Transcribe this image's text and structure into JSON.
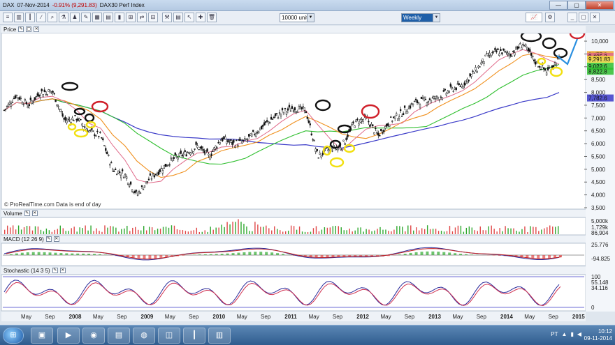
{
  "titlebar": {
    "symbol": "DAX",
    "date": "07-Nov-2014",
    "change": "-0.91% (9,291.83)",
    "index_name": "DAX30 Perf Index",
    "min_label": "—",
    "max_label": "▢",
    "close_label": "✕"
  },
  "toolbar": {
    "units_value": "10000 units",
    "period_value": "Weekly"
  },
  "panels": {
    "price": "Price",
    "volume": "Volume",
    "macd": "MACD (12 26 9)",
    "stochastic": "Stochastic (14 3 5)"
  },
  "watermark": "© ProRealTime.com  Data is end of day",
  "price_axis": [
    "10,000",
    "9,500",
    "9,000",
    "8,500",
    "8,000",
    "7,500",
    "7,000",
    "6,500",
    "6,000",
    "5,500",
    "5,000",
    "4,500",
    "4,000",
    "3,500"
  ],
  "price_tags": {
    "t1": "9,477.3",
    "t2": "9,405.3",
    "t3": "9,291.83",
    "t4": "9,022.6",
    "t5": "8,822.8",
    "t6": "7,782.6"
  },
  "volume_axis": [
    "5,000k",
    "1,729k",
    "86,904"
  ],
  "macd_axis": [
    "25.776",
    "-94.825"
  ],
  "stoch_axis": [
    "100",
    "55.148",
    "34.116",
    "0"
  ],
  "time_axis": [
    "May",
    "Sep",
    "2008",
    "May",
    "Sep",
    "2009",
    "May",
    "Sep",
    "2010",
    "May",
    "Sep",
    "2011",
    "May",
    "Sep",
    "2012",
    "May",
    "Sep",
    "2013",
    "May",
    "Sep",
    "2014",
    "May",
    "Sep",
    "2015"
  ],
  "chart_data": {
    "type": "line",
    "title": "DAX30 Perf Index",
    "x": [
      "2007-04",
      "2007-06",
      "2007-08",
      "2007-10",
      "2007-12",
      "2008-02",
      "2008-04",
      "2008-06",
      "2008-08",
      "2008-10",
      "2008-12",
      "2009-02",
      "2009-04",
      "2009-06",
      "2009-08",
      "2009-10",
      "2009-12",
      "2010-02",
      "2010-04",
      "2010-06",
      "2010-08",
      "2010-10",
      "2010-12",
      "2011-02",
      "2011-04",
      "2011-06",
      "2011-08",
      "2011-10",
      "2011-12",
      "2012-02",
      "2012-04",
      "2012-06",
      "2012-08",
      "2012-10",
      "2012-12",
      "2013-02",
      "2013-04",
      "2013-06",
      "2013-08",
      "2013-10",
      "2013-12",
      "2014-02",
      "2014-04",
      "2014-06",
      "2014-08",
      "2014-10",
      "2014-11"
    ],
    "series": [
      {
        "values": [
          7300,
          7900,
          7500,
          8000,
          8050,
          6900,
          7000,
          6500,
          6300,
          5000,
          4800,
          4000,
          4600,
          5000,
          5400,
          5600,
          5900,
          5500,
          6200,
          6000,
          6100,
          6500,
          6900,
          7200,
          7400,
          7300,
          5500,
          5800,
          5900,
          6800,
          7000,
          6300,
          6900,
          7200,
          7600,
          7700,
          7800,
          8100,
          8300,
          8800,
          9400,
          9600,
          9500,
          9900,
          9200,
          8800,
          9300
        ]
      }
    ],
    "ylim": [
      3500,
      10300
    ],
    "grid": false
  }
}
